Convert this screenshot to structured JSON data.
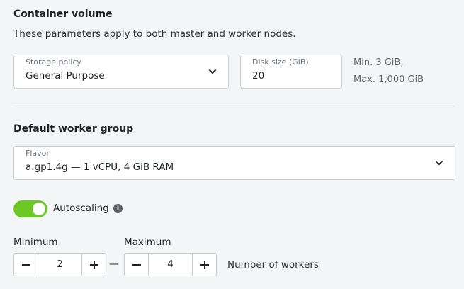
{
  "container_volume": {
    "title": "Container volume",
    "description": "These parameters apply to both master and worker nodes.",
    "storage_policy": {
      "label": "Storage policy",
      "value": "General Purpose"
    },
    "disk_size": {
      "label": "Disk size (GiB)",
      "value": "20"
    },
    "hint_min": "Min. 3 GiB,",
    "hint_max": "Max. 1,000 GiB"
  },
  "worker_group": {
    "title": "Default worker group",
    "flavor": {
      "label": "Flavor",
      "value": "a.gp1.4g — 1 vCPU, 4 GiB RAM"
    },
    "autoscaling": {
      "label": "Autoscaling",
      "enabled": true
    },
    "minimum": {
      "label": "Minimum",
      "value": "2"
    },
    "maximum": {
      "label": "Maximum",
      "value": "4"
    },
    "range_separator": "—",
    "unit_label": "Number of workers"
  },
  "colors": {
    "toggle_on": "#6cc925",
    "border": "#c7cbd1",
    "background": "#f4f5f7"
  },
  "icons": {
    "dropdown": "chevron-down-icon",
    "info": "info-icon",
    "decrement": "minus-icon",
    "increment": "plus-icon"
  }
}
